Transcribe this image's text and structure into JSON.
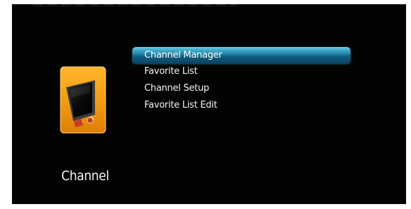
{
  "screen": {
    "category_label": "Channel",
    "icon": "tv-icon",
    "menu_items": [
      {
        "label": "Channel Manager",
        "selected": true
      },
      {
        "label": "Favorite List",
        "selected": false
      },
      {
        "label": "Channel Setup",
        "selected": false
      },
      {
        "label": "Favorite List Edit",
        "selected": false
      }
    ]
  },
  "colors": {
    "background": "#030303",
    "selection": "#298eb0",
    "icon_orange": "#f29a13",
    "text": "#f4f4f4"
  }
}
